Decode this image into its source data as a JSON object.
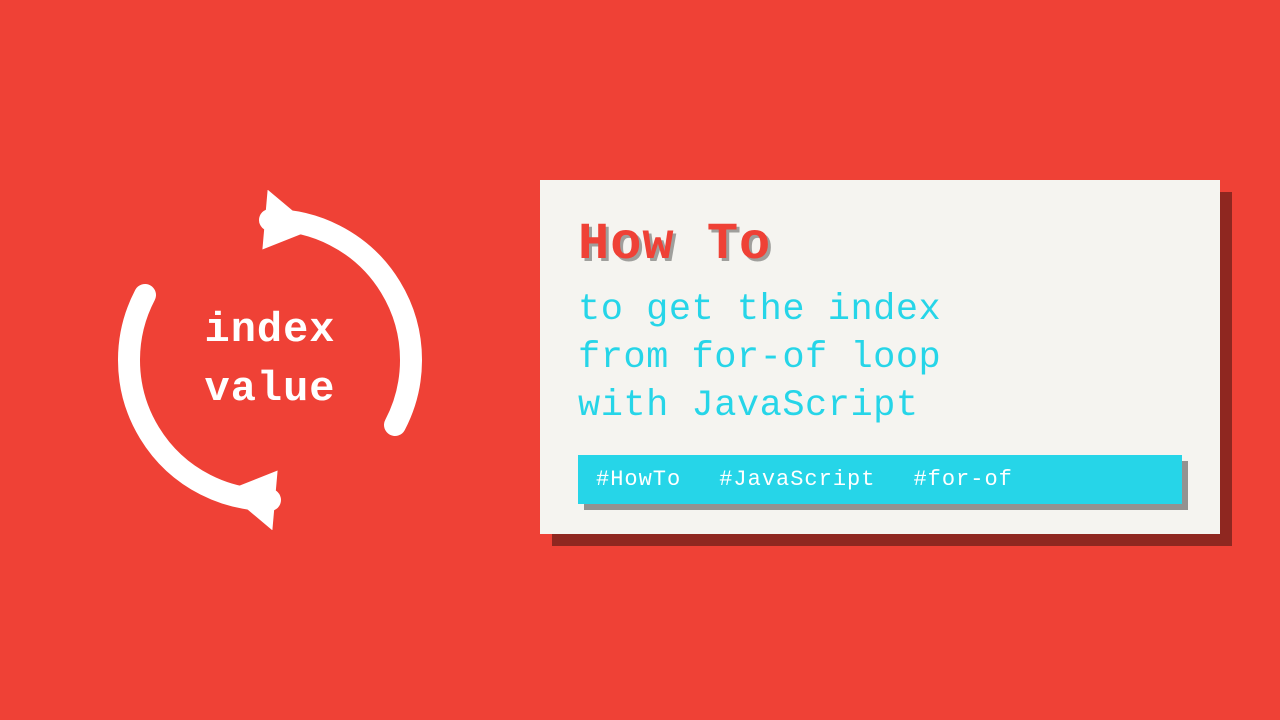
{
  "graphic": {
    "line1": "index",
    "line2": "value"
  },
  "card": {
    "title": "How To",
    "subtitle": "to get the index\nfrom for-of loop\nwith JavaScript",
    "tags": [
      "#HowTo",
      "#JavaScript",
      "#for-of"
    ]
  }
}
